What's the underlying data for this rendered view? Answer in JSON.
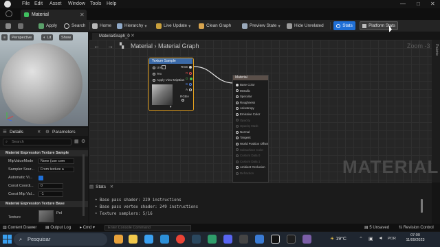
{
  "menu": {
    "items": [
      "File",
      "Edit",
      "Asset",
      "Window",
      "Tools",
      "Help"
    ]
  },
  "editor_tab": {
    "label": "Material"
  },
  "toolbar": {
    "items": [
      "Apply",
      "Search",
      "Home",
      "Hierarchy",
      "Live Update",
      "Clean Graph",
      "Preview State",
      "Hide Unrelated",
      "Stats",
      "Platform Stats"
    ]
  },
  "viewport": {
    "perspective": "Perspective",
    "lit": "Lit",
    "show": "Show"
  },
  "details": {
    "tab_details": "Details",
    "tab_parameters": "Parameters",
    "search_placeholder": "Search",
    "section1": "Material Expression Texture Sample",
    "props": [
      {
        "label": "MipValueMode",
        "value": "None (use com"
      },
      {
        "label": "Sampler Sour...",
        "value": "From texture a"
      },
      {
        "label": "Automatic Vi...",
        "value": ""
      },
      {
        "label": "Const Coordi...",
        "value": "0"
      },
      {
        "label": "Const Mip Val...",
        "value": "-1"
      }
    ],
    "section2": "Material Expression Texture Base",
    "texture_label": "Texture",
    "texture_value": "Pol"
  },
  "graph": {
    "tab_label": "MaterialGraph_0",
    "breadcrumb_root": "Material",
    "breadcrumb_sep": "›",
    "breadcrumb_leaf": "Material Graph",
    "zoom": "Zoom -3",
    "palette": "Palette",
    "watermark": "MATERIAL"
  },
  "node_texture": {
    "title": "Texture Sample",
    "inputs": [
      "UVs",
      "Tex",
      "Apply View MipBias"
    ],
    "outputs": [
      "RGB",
      "R",
      "G",
      "B",
      "A",
      "RGBA"
    ]
  },
  "node_main": {
    "title": "Material",
    "pins": [
      {
        "label": "Base Color",
        "active": true
      },
      {
        "label": "Metallic",
        "active": true
      },
      {
        "label": "Specular",
        "active": true
      },
      {
        "label": "Roughness",
        "active": true
      },
      {
        "label": "Anisotropy",
        "active": true
      },
      {
        "label": "Emissive Color",
        "active": true
      },
      {
        "label": "Opacity",
        "active": false
      },
      {
        "label": "Opacity Mask",
        "active": false
      },
      {
        "label": "Normal",
        "active": true
      },
      {
        "label": "Tangent",
        "active": true
      },
      {
        "label": "World Position Offset",
        "active": true
      },
      {
        "label": "Subsurface Color",
        "active": false
      },
      {
        "label": "Custom Data 0",
        "active": false
      },
      {
        "label": "Custom Data 1",
        "active": false
      },
      {
        "label": "Ambient Occlusion",
        "active": true
      },
      {
        "label": "Refraction",
        "active": false
      }
    ]
  },
  "stats": {
    "title": "Stats",
    "lines": [
      "Base pass shader: 229 instructions",
      "Base pass vertex shader: 249 instructions",
      "Texture samplers: 5/16"
    ]
  },
  "statusbar": {
    "content_drawer": "Content Drawer",
    "output_log": "Output Log",
    "cmd": "Cmd",
    "console_placeholder": "Enter Console Command",
    "unsaved": "5 Unsaved",
    "revision": "Revision Control"
  },
  "taskbar": {
    "search_placeholder": "Pesquisar",
    "weather": "19°C",
    "time": "07:00",
    "date": "11/09/2023",
    "lang": "POR"
  },
  "colors": {
    "accent": "#1f6fd6",
    "selected_node": "#e7a31f",
    "texture_header": "#3b6aa8"
  }
}
